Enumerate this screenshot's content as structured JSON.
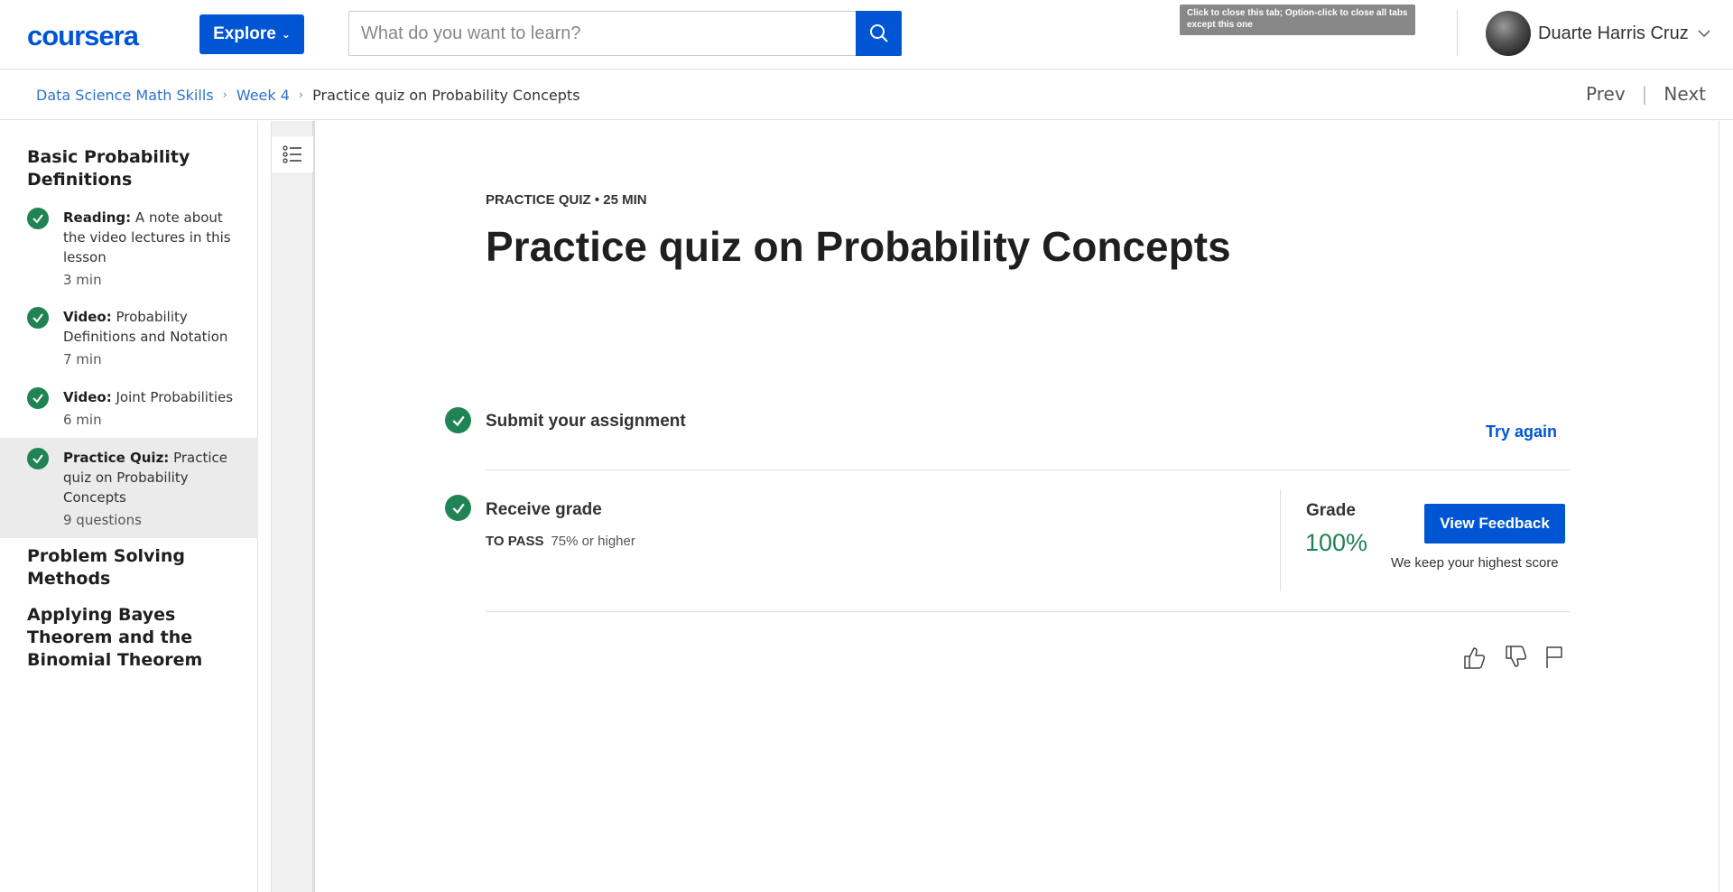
{
  "header": {
    "logo_text": "coursera",
    "explore_label": "Explore",
    "search_placeholder": "What do you want to learn?",
    "tooltip": "Click to close this tab; Option-click to close all tabs except this one",
    "user_name": "Duarte Harris Cruz",
    "brand_color": "#0056d2"
  },
  "breadcrumb": {
    "items": [
      "Data Science Math Skills",
      "Week 4",
      "Practice quiz on Probability Concepts"
    ],
    "prev_label": "Prev",
    "next_label": "Next"
  },
  "sidebar": {
    "sections": [
      "Basic Probability Definitions",
      "Problem Solving Methods",
      "Applying Bayes Theorem and the Binomial Theorem"
    ],
    "items": [
      {
        "type": "Reading:",
        "title": "A note about the video lectures in this lesson",
        "meta": "3 min",
        "completed": true
      },
      {
        "type": "Video:",
        "title": "Probability Definitions and Notation",
        "meta": "7 min",
        "completed": true
      },
      {
        "type": "Video:",
        "title": "Joint Probabilities",
        "meta": "6 min",
        "completed": true
      },
      {
        "type": "Practice Quiz:",
        "title": "Practice quiz on Probability Concepts",
        "meta": "9 questions",
        "completed": true,
        "active": true
      }
    ]
  },
  "main": {
    "kicker": "PRACTICE QUIZ • 25 MIN",
    "title": "Practice quiz on Probability Concepts",
    "submit_label": "Submit your assignment",
    "try_again_label": "Try again",
    "receive_label": "Receive grade",
    "to_pass_label": "TO PASS",
    "to_pass_value": "75% or higher",
    "grade_label": "Grade",
    "grade_value": "100%",
    "view_feedback_label": "View Feedback",
    "highest_note": "We keep your highest score",
    "success_color": "#1f8354"
  }
}
